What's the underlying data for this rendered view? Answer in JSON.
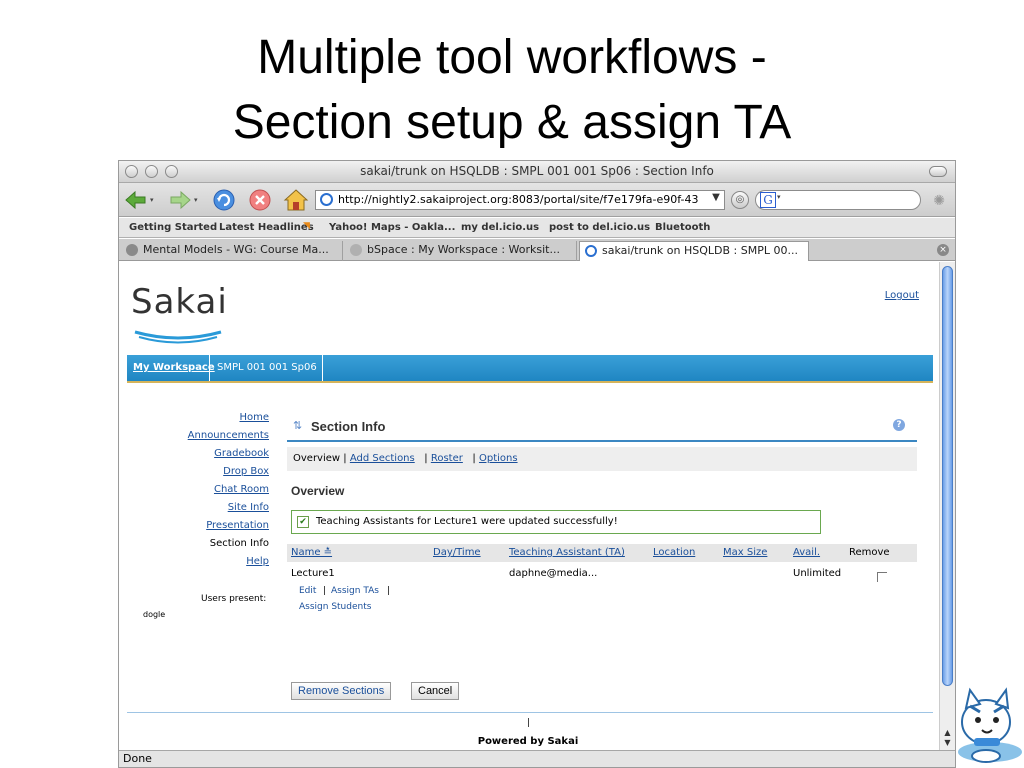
{
  "slide": {
    "title_line1": "Multiple tool workflows -",
    "title_line2": "Section setup & assign TA"
  },
  "window": {
    "title": "sakai/trunk on HSQLDB : SMPL 001 001 Sp06 : Section Info",
    "url": "http://nightly2.sakaiproject.org:8083/portal/site/f7e179fa-e90f-43",
    "url_dropdown": "▼",
    "status": "Done"
  },
  "bookmarks": [
    "Getting Started",
    "Latest Headlines",
    "Yahoo! Maps - Oakla...",
    "my del.icio.us",
    "post to del.icio.us",
    "Bluetooth"
  ],
  "tabs": [
    "Mental Models - WG: Course Ma...",
    "bSpace : My Workspace : Worksit...",
    "sakai/trunk on HSQLDB : SMPL 00..."
  ],
  "sakai": {
    "logo": "Sakai",
    "logout": "Logout",
    "site_tabs": [
      "My Workspace",
      "SMPL 001 001 Sp06"
    ],
    "tool_menu": [
      "Home",
      "Announcements",
      "Gradebook",
      "Drop Box",
      "Chat Room",
      "Site Info",
      "Presentation",
      "Section Info",
      "Help"
    ],
    "users_present": "Users present:",
    "user": "dogle",
    "tool_title": "Section Info",
    "subnav": {
      "overview": "Overview",
      "sep1": " | ",
      "add_sections": "Add Sections",
      "sep2": "| ",
      "roster": "Roster",
      "sep3": "| ",
      "options": "Options"
    },
    "overview_heading": "Overview",
    "success_message": "Teaching Assistants for Lecture1 were updated successfully!",
    "columns": {
      "name": "Name ≛",
      "daytime": "Day/Time",
      "ta": "Teaching Assistant (TA)",
      "location": "Location",
      "max_size": "Max Size",
      "avail": "Avail.",
      "remove": "Remove"
    },
    "row": {
      "name": "Lecture1",
      "ta": "daphne@media...",
      "avail": "Unlimited",
      "edit": "Edit",
      "sep_a": "|",
      "assign_tas": "Assign TAs",
      "sep_b": "|",
      "assign_students": "Assign Students"
    },
    "buttons": {
      "remove_sections": "Remove Sections",
      "cancel": "Cancel"
    },
    "footer_sep": "|",
    "powered_by": "Powered by Sakai"
  },
  "colors": {
    "site_nav": "#1f86c2",
    "accent_gold": "#d5b45a",
    "link": "#1a4f9a",
    "success_border": "#6aa84f"
  }
}
